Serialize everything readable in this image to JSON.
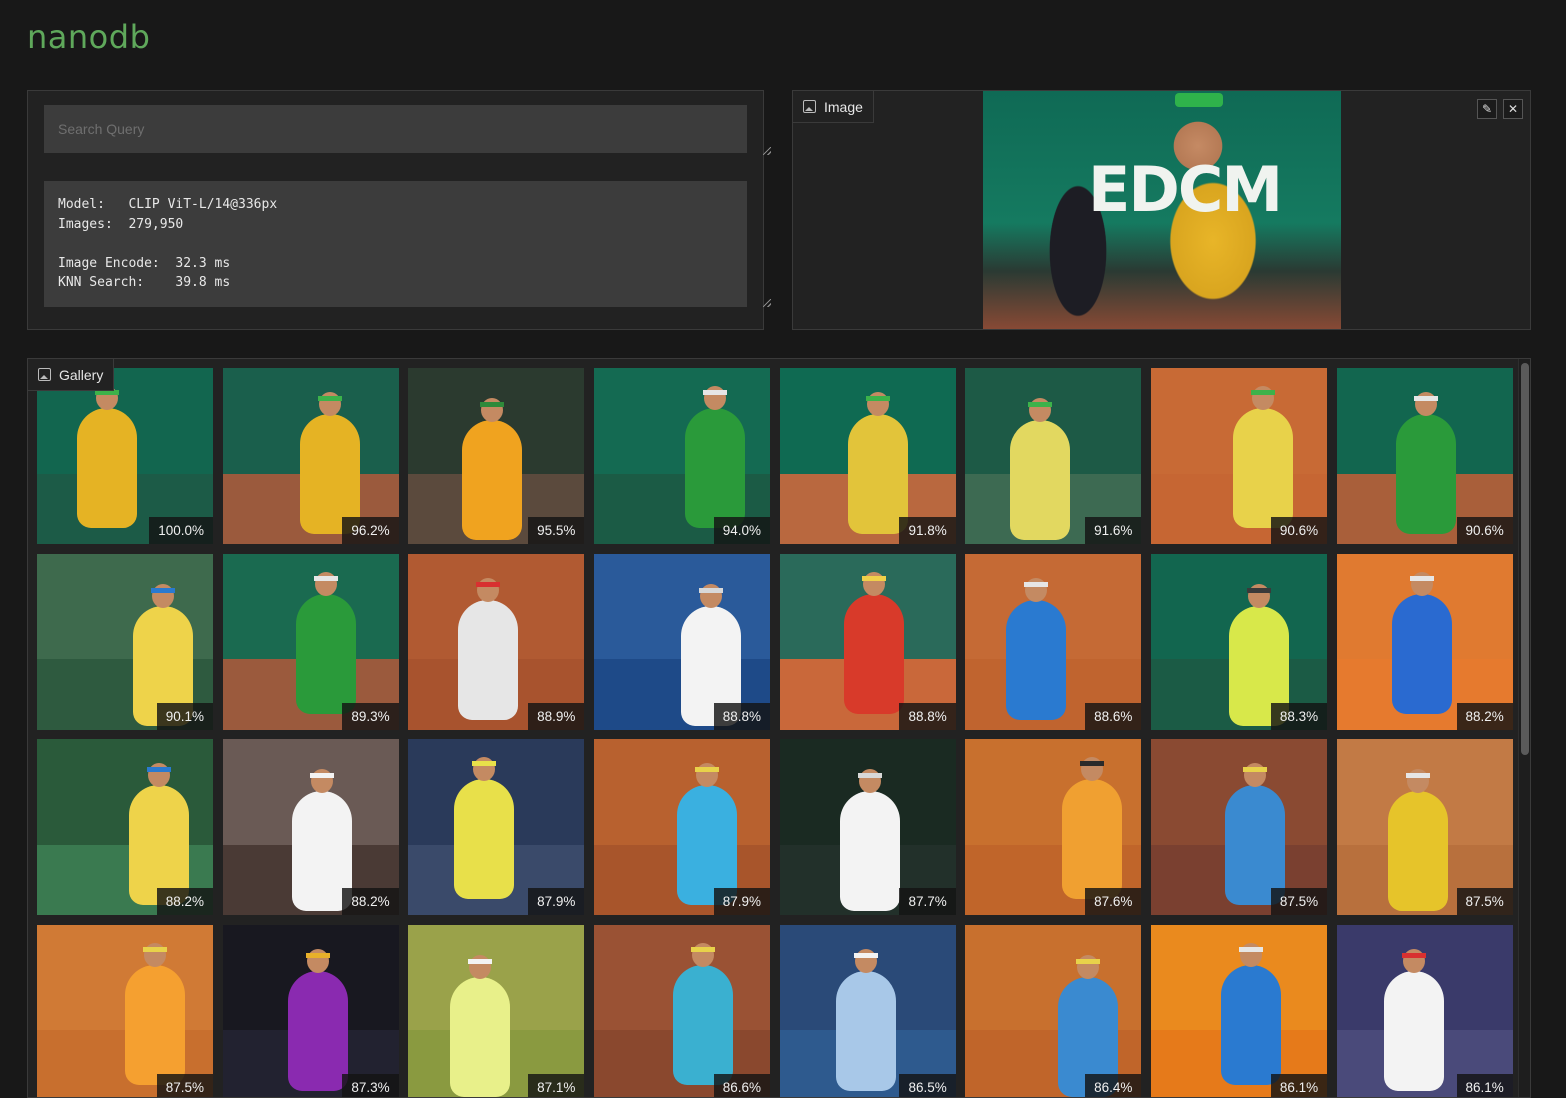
{
  "app": {
    "title": "nanodb"
  },
  "query": {
    "placeholder": "Search Query",
    "stats": "Model:   CLIP ViT-L/14@336px\nImages:  279,950\n\nImage Encode:  32.3 ms\nKNN Search:    39.8 ms"
  },
  "image_panel": {
    "label": "Image",
    "edit_icon": "pencil-icon",
    "close_icon": "close-icon"
  },
  "gallery": {
    "label": "Gallery",
    "items": [
      {
        "score": "100.0%",
        "bg": "#12664f",
        "court": "#1c5b47",
        "shirt": "#e5b324",
        "band": "#3cb24a"
      },
      {
        "score": "96.2%",
        "bg": "#1a5f4c",
        "court": "#9b5a3d",
        "shirt": "#e5b324",
        "band": "#3cb24a"
      },
      {
        "score": "95.5%",
        "bg": "#2b3a2f",
        "court": "#5b4a3d",
        "shirt": "#f0a31f",
        "band": "#2e8a3a"
      },
      {
        "score": "94.0%",
        "bg": "#146a52",
        "court": "#1b5b45",
        "shirt": "#2a9a3a",
        "band": "#e6e6e6"
      },
      {
        "score": "91.8%",
        "bg": "#0f6a52",
        "court": "#b9683f",
        "shirt": "#e2c43a",
        "band": "#3cb24a"
      },
      {
        "score": "91.6%",
        "bg": "#1d5a46",
        "court": "#3d6a52",
        "shirt": "#e2d860",
        "band": "#3cb24a"
      },
      {
        "score": "90.6%",
        "bg": "#c86a35",
        "court": "#c66633",
        "shirt": "#e8d24a",
        "band": "#3cb24a"
      },
      {
        "score": "90.6%",
        "bg": "#12664f",
        "court": "#a95f3a",
        "shirt": "#2a9a3a",
        "band": "#e6e6e6"
      },
      {
        "score": "90.1%",
        "bg": "#3e6a4d",
        "court": "#2e5a3f",
        "shirt": "#eed34a",
        "band": "#2a7ad0"
      },
      {
        "score": "89.3%",
        "bg": "#1a6a50",
        "court": "#9b5a3d",
        "shirt": "#2a9a3a",
        "band": "#e6e6e6"
      },
      {
        "score": "88.9%",
        "bg": "#b15a32",
        "court": "#a8532e",
        "shirt": "#e6e6e6",
        "band": "#d83030"
      },
      {
        "score": "88.8%",
        "bg": "#2a5a9a",
        "court": "#1e4a88",
        "shirt": "#f3f3f3",
        "band": "#d8d8d8"
      },
      {
        "score": "88.8%",
        "bg": "#2a6a5a",
        "court": "#c9683a",
        "shirt": "#d83a2a",
        "band": "#f0d04a"
      },
      {
        "score": "88.6%",
        "bg": "#c56a35",
        "court": "#c0642f",
        "shirt": "#2a7ad0",
        "band": "#e6e6e6"
      },
      {
        "score": "88.3%",
        "bg": "#12664f",
        "court": "#1b5b45",
        "shirt": "#d8e84a",
        "band": "#3a3a3a"
      },
      {
        "score": "88.2%",
        "bg": "#e07a30",
        "court": "#e67a2e",
        "shirt": "#2a6ad0",
        "band": "#e6e6e6"
      },
      {
        "score": "88.2%",
        "bg": "#2a5a3a",
        "court": "#3a7a50",
        "shirt": "#eed34a",
        "band": "#2a7ad0"
      },
      {
        "score": "88.2%",
        "bg": "#6a5a55",
        "court": "#4a3a35",
        "shirt": "#f3f3f3",
        "band": "#f3f3f3"
      },
      {
        "score": "87.9%",
        "bg": "#2a3a5a",
        "court": "#3a4a6a",
        "shirt": "#e8e04a",
        "band": "#e8e04a"
      },
      {
        "score": "87.9%",
        "bg": "#b8612f",
        "court": "#a8552b",
        "shirt": "#3ab0e0",
        "band": "#e8d24a"
      },
      {
        "score": "87.7%",
        "bg": "#1a2a22",
        "court": "#22302a",
        "shirt": "#f3f3f3",
        "band": "#d8d8d8"
      },
      {
        "score": "87.6%",
        "bg": "#c8702e",
        "court": "#c0652a",
        "shirt": "#f0a031",
        "band": "#2a2a2a"
      },
      {
        "score": "87.5%",
        "bg": "#8a4a32",
        "court": "#7a4030",
        "shirt": "#3a8ad0",
        "band": "#e8d24a"
      },
      {
        "score": "87.5%",
        "bg": "#c27a45",
        "court": "#b8703d",
        "shirt": "#e6c42a",
        "band": "#e6e6e6"
      },
      {
        "score": "87.5%",
        "bg": "#d07a35",
        "court": "#c86f2e",
        "shirt": "#f5a030",
        "band": "#e8d24a"
      },
      {
        "score": "87.3%",
        "bg": "#181820",
        "court": "#222230",
        "shirt": "#8a2ab0",
        "band": "#e8b02a"
      },
      {
        "score": "87.1%",
        "bg": "#9aa24a",
        "court": "#8a9a40",
        "shirt": "#e8f08a",
        "band": "#f3f3f3"
      },
      {
        "score": "86.6%",
        "bg": "#9a5234",
        "court": "#8a482e",
        "shirt": "#3ab0d0",
        "band": "#e8d24a"
      },
      {
        "score": "86.5%",
        "bg": "#2a4a78",
        "court": "#2e5a8e",
        "shirt": "#a8c8e8",
        "band": "#f3f3f3"
      },
      {
        "score": "86.4%",
        "bg": "#c8702e",
        "court": "#c0652a",
        "shirt": "#3a8ad0",
        "band": "#e8d24a"
      },
      {
        "score": "86.1%",
        "bg": "#ea8a1e",
        "court": "#e67a1a",
        "shirt": "#2a7ad0",
        "band": "#e6e6e6"
      },
      {
        "score": "86.1%",
        "bg": "#3a3a6a",
        "court": "#4a4a7a",
        "shirt": "#f3f3f3",
        "band": "#d83030"
      }
    ]
  }
}
